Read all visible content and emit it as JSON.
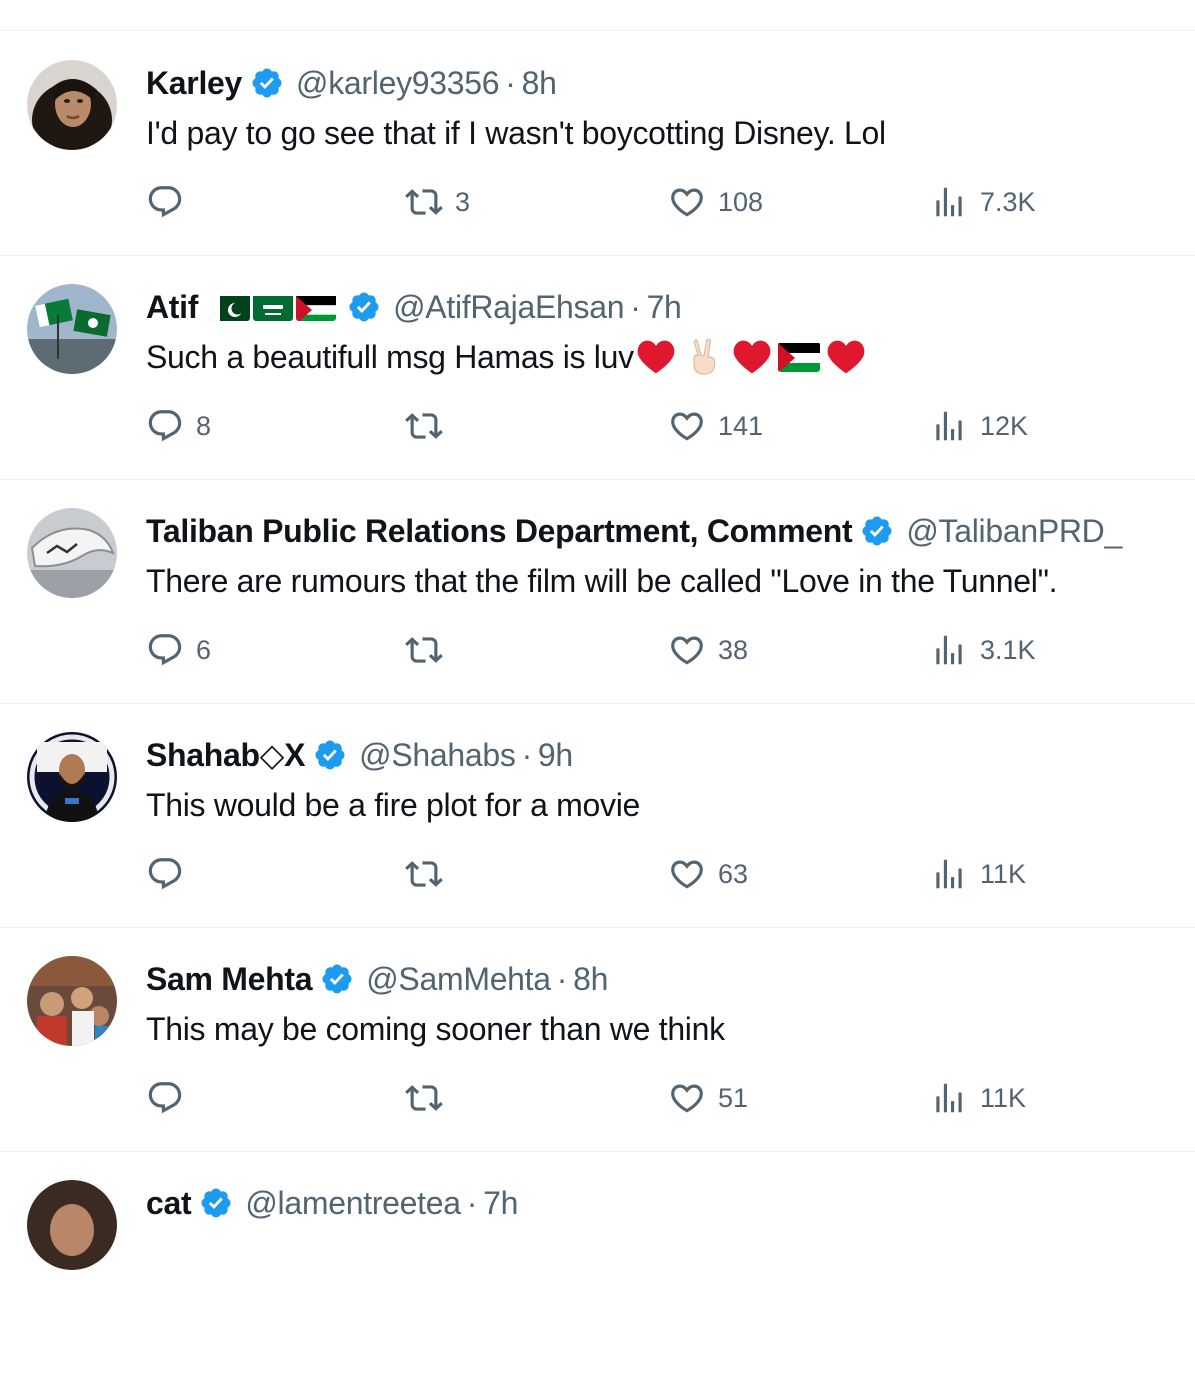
{
  "replies": [
    {
      "name": "Karley",
      "handle": "@karley93356",
      "dot": "·",
      "time": "8h",
      "text": "I'd pay to go see that if I wasn't boycotting Disney. Lol",
      "replies": "",
      "reposts": "3",
      "likes": "108",
      "views": "7.3K"
    },
    {
      "name": "Atif",
      "handle": "@AtifRajaEhsan",
      "dot": "·",
      "time": "7h",
      "text": "Such a beautifull msg Hamas is luv",
      "replies": "8",
      "reposts": "",
      "likes": "141",
      "views": "12K"
    },
    {
      "name": "Taliban Public Relations Department, Comment",
      "handle": "@TalibanPRD_",
      "dot": "",
      "time": "",
      "text": "There are rumours that the film will be called \"Love in the Tunnel\".",
      "replies": "6",
      "reposts": "",
      "likes": "38",
      "views": "3.1K"
    },
    {
      "name": "Shahab◇X",
      "handle": "@Shahabs",
      "dot": "·",
      "time": "9h",
      "text": "This would be a fire plot for a movie",
      "replies": "",
      "reposts": "",
      "likes": "63",
      "views": "11K"
    },
    {
      "name": "Sam Mehta",
      "handle": "@SamMehta",
      "dot": "·",
      "time": "8h",
      "text": "This may be coming sooner than we think",
      "replies": "",
      "reposts": "",
      "likes": "51",
      "views": "11K"
    },
    {
      "name": "cat",
      "handle": "@lamentreetea",
      "dot": "·",
      "time": "7h"
    }
  ],
  "icons": {
    "reply": "reply-icon",
    "repost": "repost-icon",
    "like": "heart-icon",
    "views": "views-icon",
    "verified": "verified-badge-icon"
  },
  "colors": {
    "text": "#0f1419",
    "secondary": "#536471",
    "verified": "#1d9bf0",
    "divider": "#eff3f4",
    "heart_emoji": "#e0182d"
  }
}
